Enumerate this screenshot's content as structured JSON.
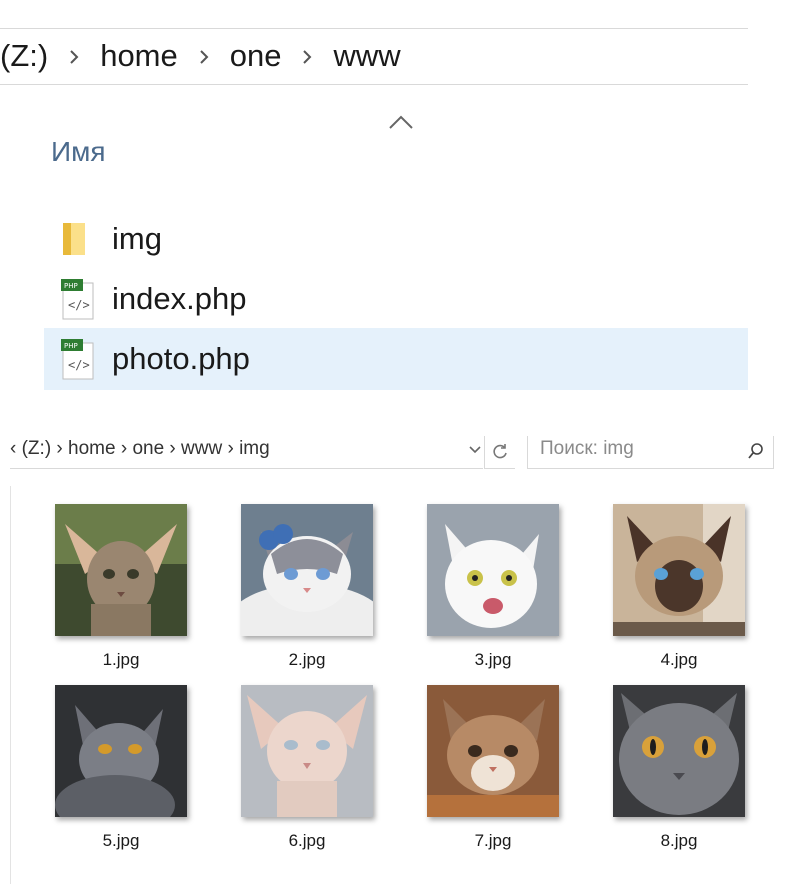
{
  "breadcrumb": {
    "drive": "(Z:)",
    "segments": [
      "home",
      "one",
      "www"
    ]
  },
  "list": {
    "column_header": "Имя",
    "items": [
      {
        "name": "img",
        "icon": "folder-icon"
      },
      {
        "name": "index.php",
        "icon": "php-file-icon"
      },
      {
        "name": "photo.php",
        "icon": "php-file-icon",
        "selected": true
      }
    ]
  },
  "window2": {
    "address_text": "‹ (Z:) › home › one › www › img",
    "search_placeholder": "Поиск: img",
    "thumbnails": [
      {
        "name": "1.jpg",
        "cat": "oriental"
      },
      {
        "name": "2.jpg",
        "cat": "ragdoll"
      },
      {
        "name": "3.jpg",
        "cat": "white"
      },
      {
        "name": "4.jpg",
        "cat": "siamese"
      },
      {
        "name": "5.jpg",
        "cat": "grey-dark"
      },
      {
        "name": "6.jpg",
        "cat": "sphynx"
      },
      {
        "name": "7.jpg",
        "cat": "tabby"
      },
      {
        "name": "8.jpg",
        "cat": "british-blue"
      }
    ]
  },
  "colors": {
    "selected_row": "#e5f1fb",
    "header_text": "#4b6a8c",
    "folder": "#f5c542"
  }
}
